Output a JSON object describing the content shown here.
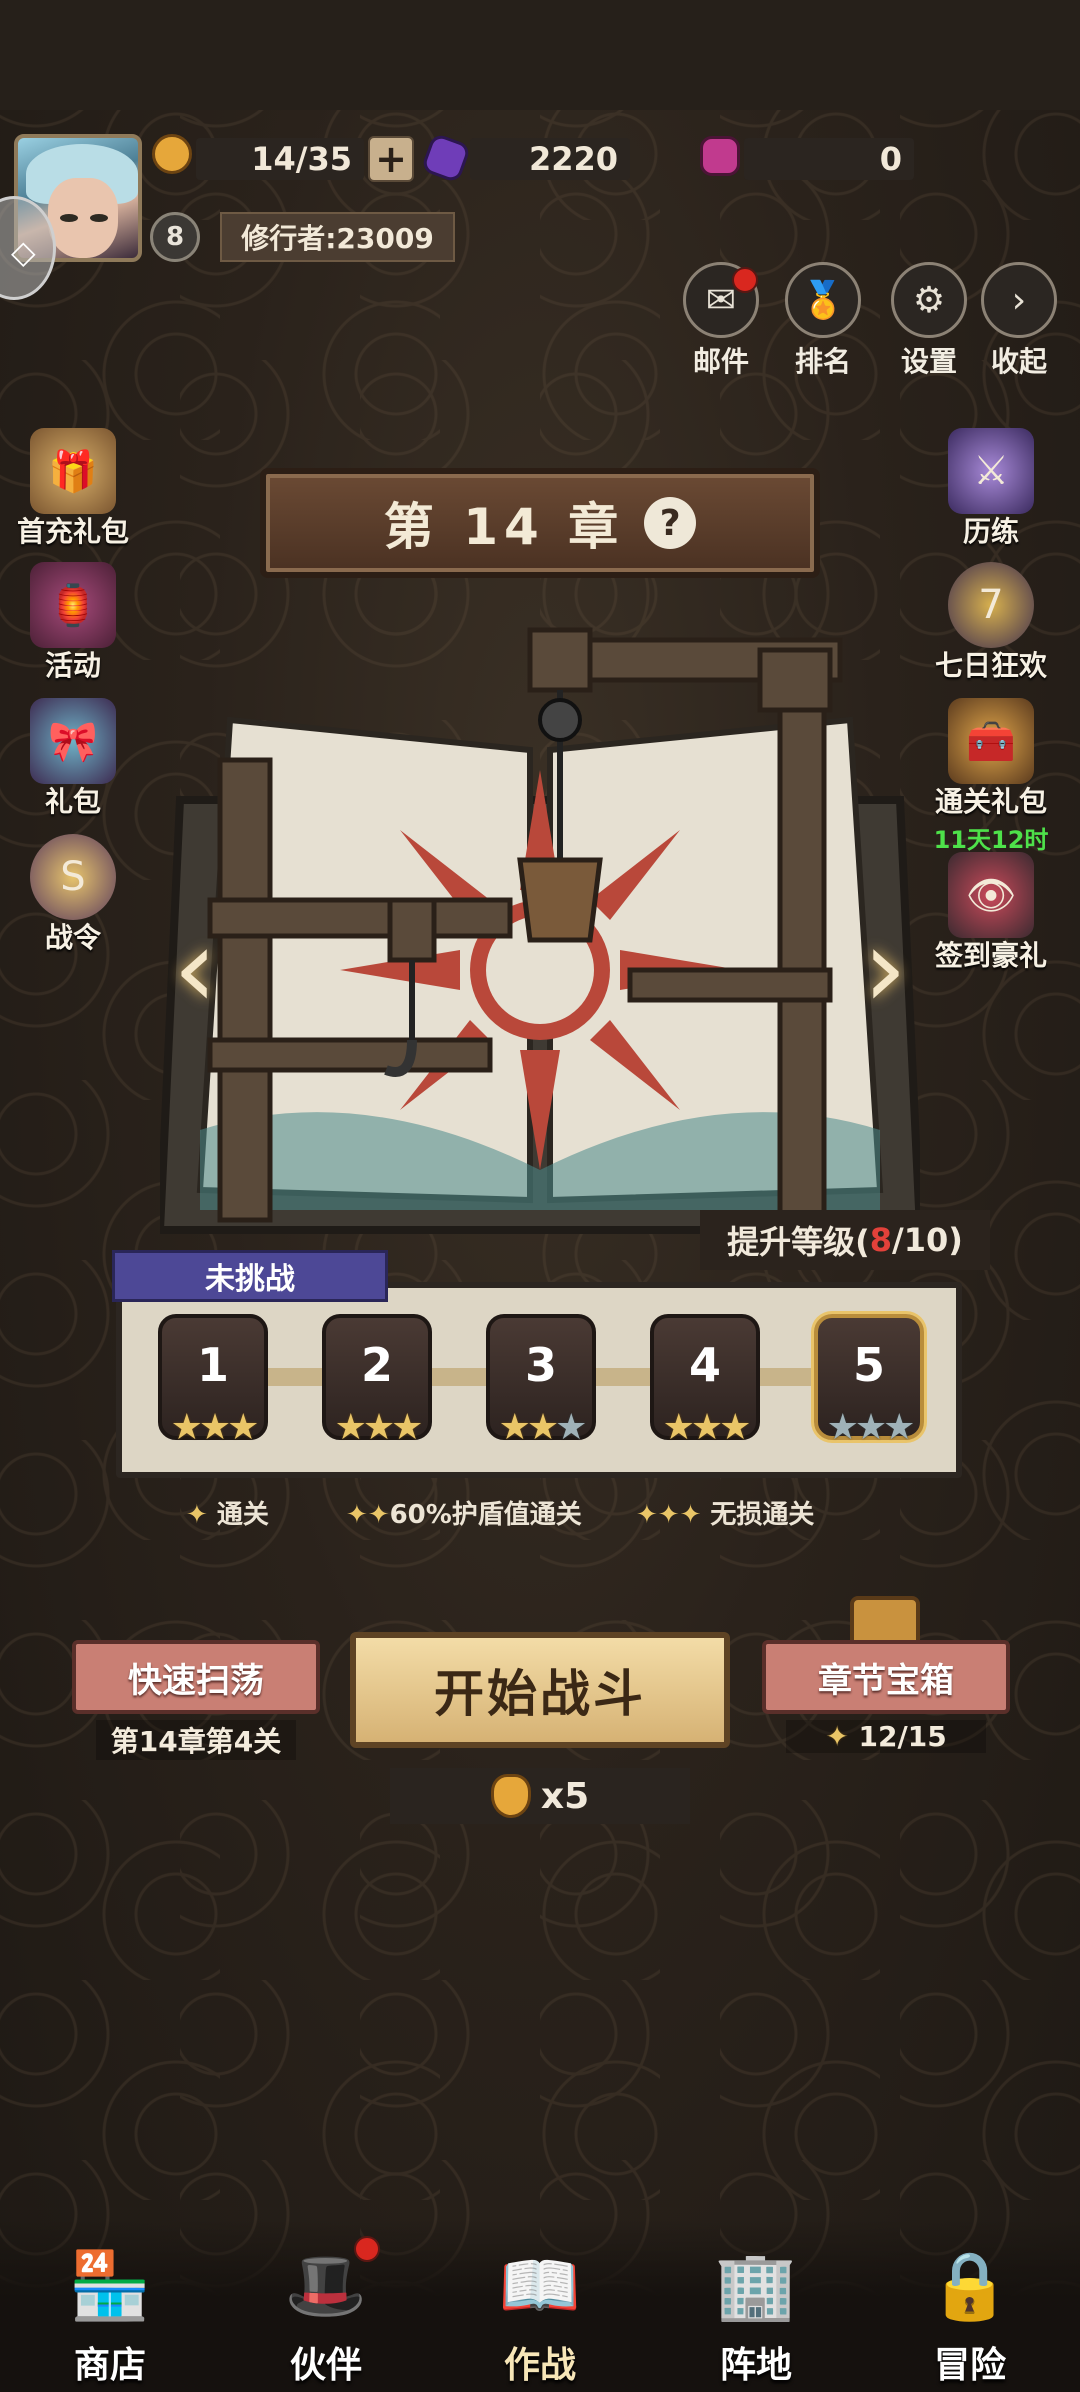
{
  "player": {
    "level": "8",
    "name": "修行者:23009"
  },
  "resources": {
    "stamina": "14/35",
    "gems": "2220",
    "tickets": "0"
  },
  "top_menu": [
    {
      "label": "邮件",
      "icon": "mail-icon",
      "badge": true
    },
    {
      "label": "排名",
      "icon": "medal-icon",
      "badge": false
    },
    {
      "label": "设置",
      "icon": "gear-icon",
      "badge": false
    },
    {
      "label": "收起",
      "icon": "chevron-right-icon",
      "badge": false
    }
  ],
  "left_menu": [
    {
      "label": "首充礼包",
      "icon": "first-charge-gift-icon"
    },
    {
      "label": "活动",
      "icon": "event-icon"
    },
    {
      "label": "礼包",
      "icon": "gift-pack-icon"
    },
    {
      "label": "战令",
      "icon": "battle-pass-icon"
    }
  ],
  "right_menu": [
    {
      "label": "历练",
      "icon": "training-icon",
      "sub": ""
    },
    {
      "label": "七日狂欢",
      "icon": "seven-day-icon",
      "sub": ""
    },
    {
      "label": "通关礼包",
      "icon": "clear-gift-icon",
      "sub": "11天12时"
    },
    {
      "label": "签到豪礼",
      "icon": "checkin-gift-icon",
      "sub": ""
    }
  ],
  "chapter": {
    "title": "第 14 章",
    "help": "?"
  },
  "upgrade": {
    "label": "提升等级(",
    "current": "8",
    "rest": "/10)"
  },
  "stages": {
    "status_tag": "未挑战",
    "items": [
      {
        "num": "1",
        "stars": 3,
        "current": false
      },
      {
        "num": "2",
        "stars": 3,
        "current": false
      },
      {
        "num": "3",
        "stars": 2,
        "current": false
      },
      {
        "num": "4",
        "stars": 3,
        "current": false
      },
      {
        "num": "5",
        "stars": 0,
        "current": true
      }
    ]
  },
  "legend": {
    "one_star": "通关",
    "two_star": "60%护盾值通关",
    "three_star": "无损通关"
  },
  "actions": {
    "sweep_label": "快速扫荡",
    "sweep_sub": "第14章第4关",
    "start_label": "开始战斗",
    "cost": "x5",
    "chest_label": "章节宝箱",
    "chest_progress": "12/15"
  },
  "bottom_nav": [
    {
      "label": "商店",
      "icon": "shop-icon",
      "active": false,
      "badge": false
    },
    {
      "label": "伙伴",
      "icon": "wizard-hat-icon",
      "active": false,
      "badge": true
    },
    {
      "label": "作战",
      "icon": "spellbook-icon",
      "active": true,
      "badge": false
    },
    {
      "label": "阵地",
      "icon": "building-icon",
      "active": false,
      "badge": false
    },
    {
      "label": "冒险",
      "icon": "locked-adventure-icon",
      "active": false,
      "badge": false
    }
  ],
  "colors": {
    "accent_gold": "#e9c567",
    "alert_red": "#d9271f",
    "timer_green": "#4ee14a",
    "tag_purple": "#4d4896"
  }
}
